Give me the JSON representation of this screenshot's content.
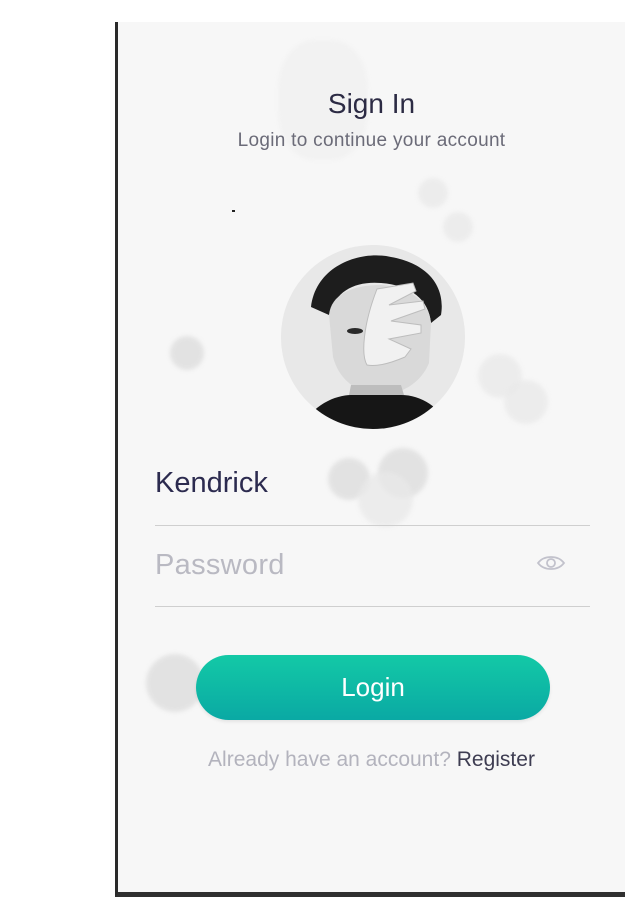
{
  "header": {
    "title": "Sign In",
    "subtitle": "Login to continue your account"
  },
  "profile": {
    "avatar_icon": "user-portrait-photo"
  },
  "form": {
    "username_value": "Kendrick",
    "password_placeholder": "Password",
    "toggle_icon": "eye-icon"
  },
  "actions": {
    "login_label": "Login"
  },
  "footer": {
    "prompt": "Already have an account?",
    "register_label": "Register"
  },
  "colors": {
    "accent_top": "#13c9a6",
    "accent_bottom": "#0aa9a4",
    "title_text": "#2c2b44"
  }
}
